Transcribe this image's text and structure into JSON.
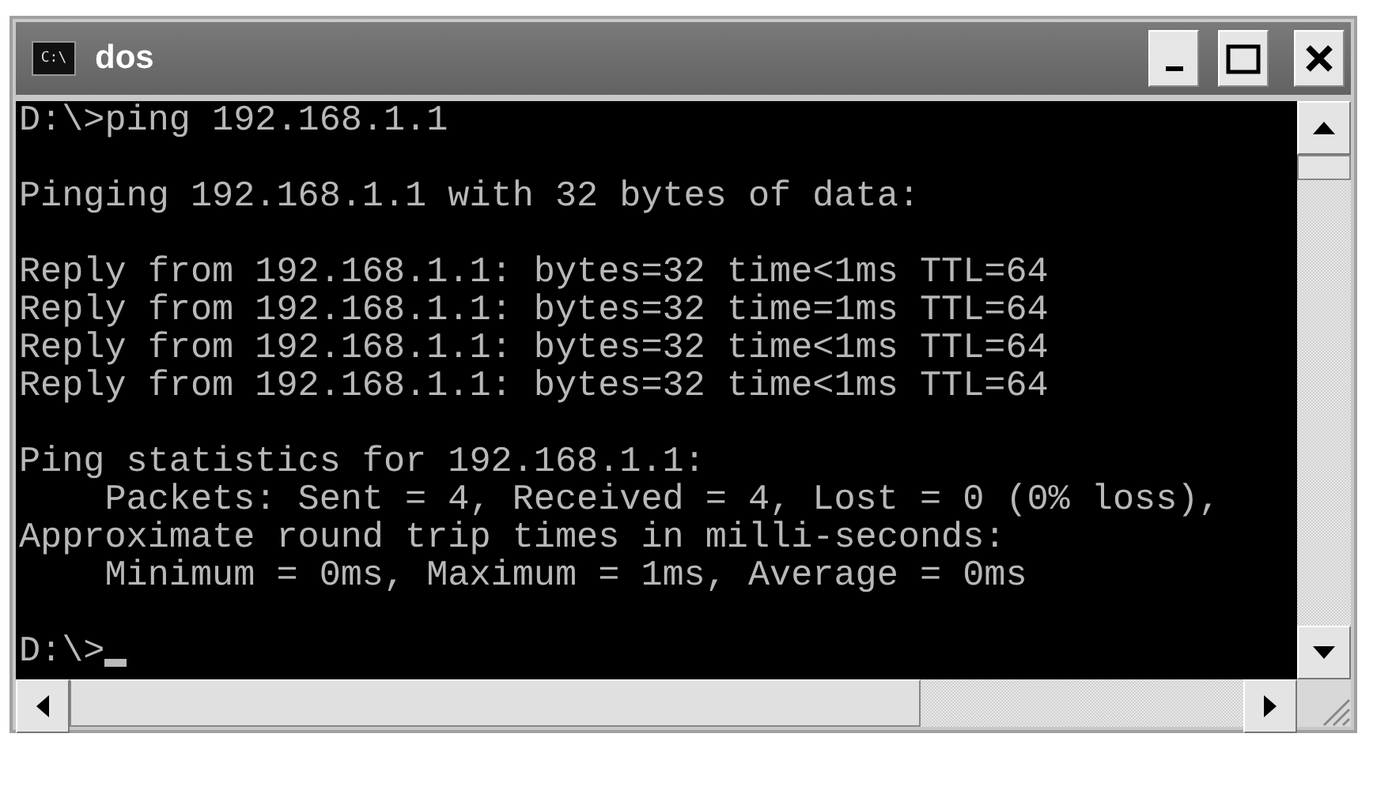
{
  "window": {
    "title": "dos",
    "icon_text": "C:\\"
  },
  "console": {
    "blocks": [
      [
        "D:\\>ping 192.168.1.1"
      ],
      [
        "Pinging 192.168.1.1 with 32 bytes of data:"
      ],
      [
        "Reply from 192.168.1.1: bytes=32 time<1ms TTL=64",
        "Reply from 192.168.1.1: bytes=32 time=1ms TTL=64",
        "Reply from 192.168.1.1: bytes=32 time<1ms TTL=64",
        "Reply from 192.168.1.1: bytes=32 time<1ms TTL=64"
      ],
      [
        "Ping statistics for 192.168.1.1:",
        "    Packets: Sent = 4, Received = 4, Lost = 0 (0% loss),",
        "Approximate round trip times in milli-seconds:",
        "    Minimum = 0ms, Maximum = 1ms, Average = 0ms"
      ],
      [
        "D:\\>"
      ]
    ],
    "cursor": true
  }
}
